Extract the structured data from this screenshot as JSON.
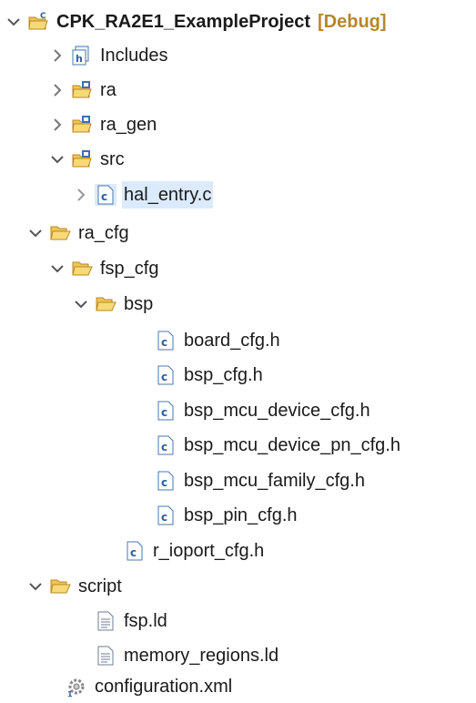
{
  "project": {
    "name": "CPK_RA2E1_ExampleProject",
    "config": "[Debug]"
  },
  "items": [
    {
      "label": "Includes"
    },
    {
      "label": "ra"
    },
    {
      "label": "ra_gen"
    },
    {
      "label": "src"
    },
    {
      "label": "hal_entry.c"
    },
    {
      "label": "ra_cfg"
    },
    {
      "label": "fsp_cfg"
    },
    {
      "label": "bsp"
    },
    {
      "label": "board_cfg.h"
    },
    {
      "label": "bsp_cfg.h"
    },
    {
      "label": "bsp_mcu_device_cfg.h"
    },
    {
      "label": "bsp_mcu_device_pn_cfg.h"
    },
    {
      "label": "bsp_mcu_family_cfg.h"
    },
    {
      "label": "bsp_pin_cfg.h"
    },
    {
      "label": "r_ioport_cfg.h"
    },
    {
      "label": "script"
    },
    {
      "label": "fsp.ld"
    },
    {
      "label": "memory_regions.ld"
    },
    {
      "label": "configuration.xml"
    }
  ],
  "icons": {
    "project": "project-folder-icon",
    "includes": "includes-icon",
    "source_folder": "source-folder-icon",
    "folder": "folder-open-icon",
    "c_file": "c-file-icon",
    "linker_file": "text-file-icon",
    "xml_config": "gear-config-icon"
  },
  "colors": {
    "selection": "#dbeafc",
    "folder": "#e0a52b",
    "debug_tag": "#b8862b",
    "c_icon_border": "#4a78b0"
  }
}
